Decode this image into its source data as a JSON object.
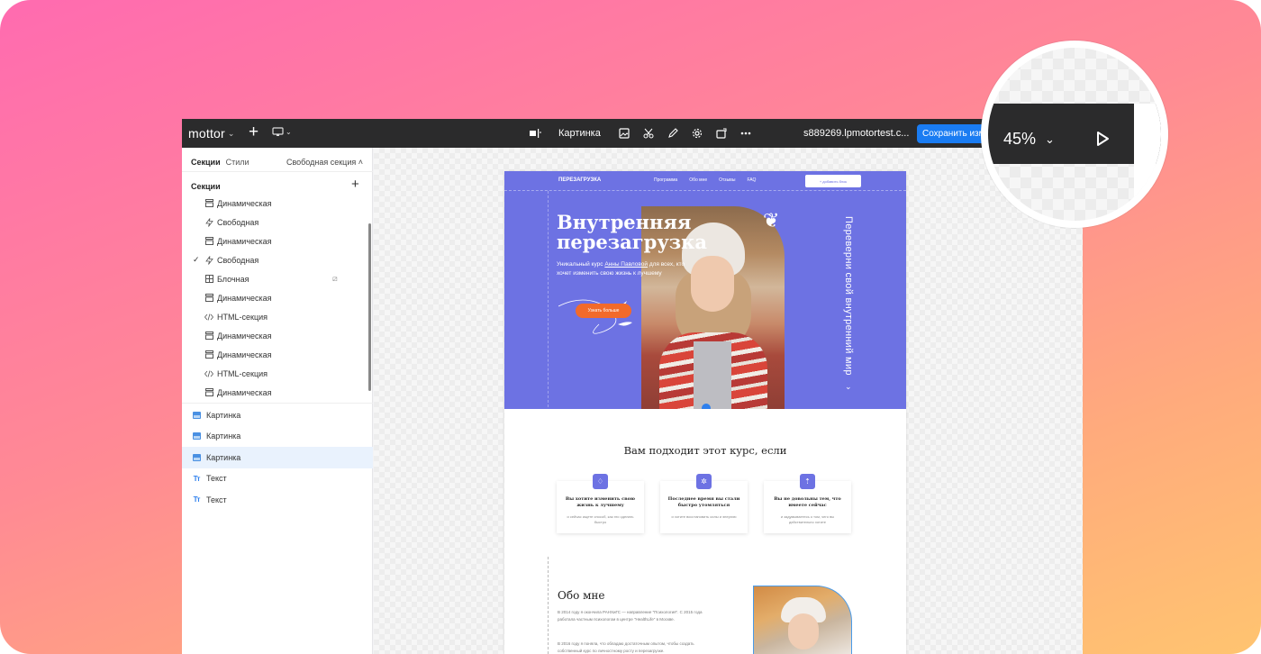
{
  "app": {
    "logo": "mottor",
    "zoom": "45%",
    "domain": "s889269.lpmotortest.c...",
    "save_label": "Сохранить изменения",
    "element_label": "Картинка"
  },
  "sidebar": {
    "tab_sections": "Секции",
    "tab_styles": "Стили",
    "free_section": "Свободная секция",
    "sections_title": "Секции",
    "sections": [
      {
        "label": "Динамическая",
        "icon": "dynamic-section-icon"
      },
      {
        "label": "Свободная",
        "icon": "free-section-icon"
      },
      {
        "label": "Динамическая",
        "icon": "dynamic-section-icon"
      },
      {
        "label": "Свободная",
        "icon": "free-section-icon",
        "checked": true
      },
      {
        "label": "Блочная",
        "icon": "block-section-icon"
      },
      {
        "label": "Динамическая",
        "icon": "dynamic-section-icon"
      },
      {
        "label": "HTML-секция",
        "icon": "code-icon"
      },
      {
        "label": "Динамическая",
        "icon": "dynamic-section-icon"
      },
      {
        "label": "Динамическая",
        "icon": "dynamic-section-icon"
      },
      {
        "label": "HTML-секция",
        "icon": "code-icon"
      },
      {
        "label": "Динамическая",
        "icon": "dynamic-section-icon"
      }
    ],
    "elements": [
      {
        "label": "Картинка",
        "type": "image"
      },
      {
        "label": "Картинка",
        "type": "image"
      },
      {
        "label": "Картинка",
        "type": "image",
        "selected": true
      },
      {
        "label": "Текст",
        "type": "text"
      },
      {
        "label": "Текст",
        "type": "text"
      }
    ]
  },
  "preview": {
    "brand": "ПЕРЕЗАГРУЗКА",
    "menu": [
      "Программа",
      "Обо мне",
      "Отзывы",
      "FAQ"
    ],
    "cta_top": "+ добавить блок",
    "hero_title_1": "Внутренняя",
    "hero_title_2": "перезагрузка",
    "hero_sub_1": "Уникальный курс",
    "hero_sub_link": "Анны Павловой",
    "hero_sub_2": "для всех, кто хочет изменить свою жизнь к лучшему",
    "hero_button": "Узнать больше",
    "vertical_text": "Переверни свой внутренний мир",
    "fit_title": "Вам подходит этот курс, если",
    "cards": [
      {
        "title": "Вы хотите изменить свою жизнь к лучшему",
        "sub": "и сейчас ищете способ, как это сделать быстро"
      },
      {
        "title": "Последнее время вы стали быстро утомляться",
        "sub": "и хотите восстановить силы и энергию"
      },
      {
        "title": "Вы не довольны тем, что имеете сейчас",
        "sub": "и задумываетесь о том, чего вы действительно хотите"
      }
    ],
    "about_title": "Обо мне",
    "about_p1": "В 2014 году я окончила РАНХиГС — направление \"Психология\". С 2015 года работала частным психологом в центре \"HealthLife\" в Москве.",
    "about_p2": "В 2016 году я поняла, что обладаю достаточным опытом, чтобы создать собственный курс по личностному росту и перезагрузке."
  },
  "colors": {
    "hero": "#6d72e3",
    "accent_button": "#f26a2a",
    "save_button": "#1a7cf2",
    "topbar": "#2b2b2c"
  }
}
